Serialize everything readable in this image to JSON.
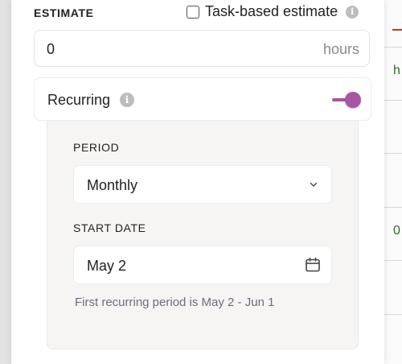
{
  "background": {
    "peek_texts": [
      "h",
      "0"
    ]
  },
  "estimate": {
    "section_label": "ESTIMATE",
    "task_based_label": "Task-based estimate",
    "task_based_checked": false,
    "hours_value": "0",
    "hours_unit": "hours"
  },
  "recurring": {
    "label": "Recurring",
    "enabled": true,
    "period_label": "PERIOD",
    "period_value": "Monthly",
    "start_date_label": "START DATE",
    "start_date_value": "May 2",
    "helper_text": "First recurring period is May 2 - Jun 1"
  },
  "colors": {
    "accent": "#a855a6",
    "helper_text": "#6f6a7e",
    "sub_panel_bg": "#f6f5f3"
  },
  "icons": {
    "info": "info-icon",
    "dropdown": "chevron-down-icon",
    "calendar": "calendar-icon"
  }
}
